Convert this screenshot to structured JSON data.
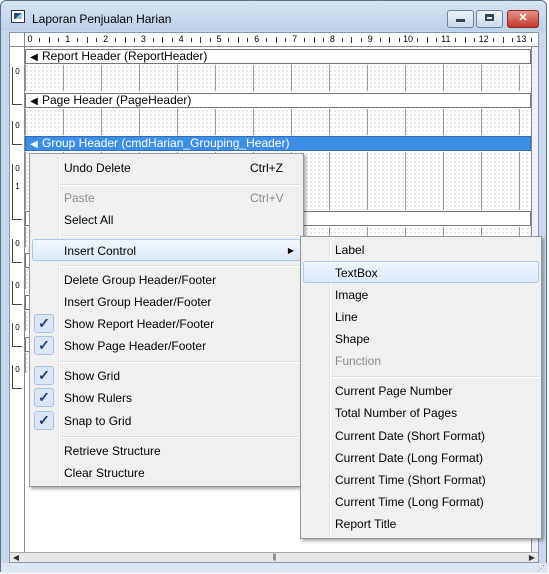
{
  "window": {
    "title": "Laporan Penjualan Harian",
    "min_glyph": "",
    "close_glyph": "✕"
  },
  "ruler": {
    "labels": [
      "0",
      "1",
      "2",
      "3",
      "4",
      "5",
      "6",
      "7",
      "8",
      "9",
      "10",
      "11",
      "12",
      "13"
    ]
  },
  "bands": {
    "report_header": "Report Header (ReportHeader)",
    "page_header": "Page Header (PageHeader)",
    "group_header": "Group Header (cmdHarian_Grouping_Header)"
  },
  "context_menu": {
    "undo_delete": "Undo Delete",
    "undo_shortcut": "Ctrl+Z",
    "paste": "Paste",
    "paste_shortcut": "Ctrl+V",
    "select_all": "Select All",
    "insert_control": "Insert Control",
    "delete_group": "Delete Group Header/Footer",
    "insert_group": "Insert Group Header/Footer",
    "show_report_header": "Show Report Header/Footer",
    "show_page_header": "Show Page Header/Footer",
    "show_grid": "Show Grid",
    "show_rulers": "Show Rulers",
    "snap_to_grid": "Snap to Grid",
    "retrieve_structure": "Retrieve Structure",
    "clear_structure": "Clear Structure",
    "check_mark": "✓",
    "submenu_arrow": "▶"
  },
  "submenu": {
    "label": "Label",
    "textbox": "TextBox",
    "image": "Image",
    "line": "Line",
    "shape": "Shape",
    "function": "Function",
    "current_page_number": "Current Page Number",
    "total_pages": "Total Number of Pages",
    "current_date_short": "Current Date (Short Format)",
    "current_date_long": "Current Date (Long Format)",
    "current_time_short": "Current Time (Short Format)",
    "current_time_long": "Current Time (Long Format)",
    "report_title": "Report Title"
  },
  "scroll": {
    "left_arrow": "◀",
    "right_arrow": "▶",
    "thumb_grip": "|||"
  },
  "colors": {
    "selected_band": "#3d8ee6",
    "close_button": "#c0392b"
  }
}
